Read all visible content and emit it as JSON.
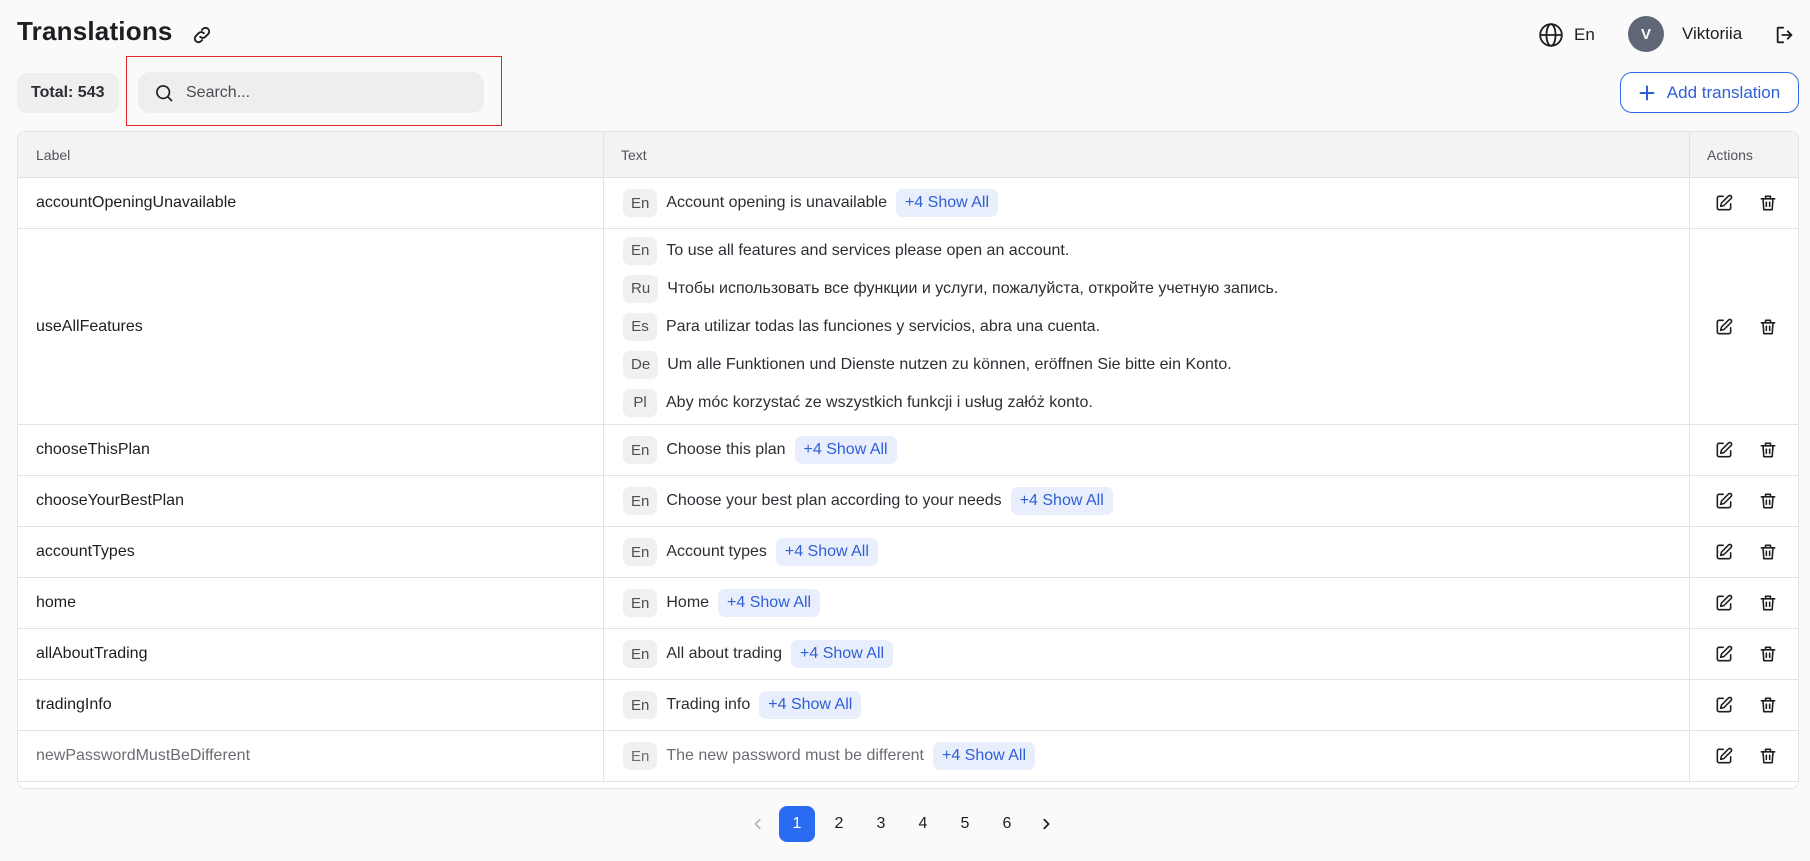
{
  "header": {
    "title": "Translations",
    "link_icon": "link-icon",
    "language": {
      "icon": "globe-icon",
      "label": "En"
    },
    "user": {
      "initial": "V",
      "name": "Viktoriia"
    },
    "logout_icon": "logout-icon"
  },
  "toolbar": {
    "total_label": "Total: 543",
    "search": {
      "placeholder": "Search...",
      "value": ""
    },
    "add_label": "Add translation"
  },
  "colors": {
    "accent": "#2a6cf1",
    "highlight_border": "#e0282e",
    "show_all_bg": "#e8eefc"
  },
  "table": {
    "columns": [
      "Label",
      "Text",
      "Actions"
    ],
    "rows": [
      {
        "label": "accountOpeningUnavailable",
        "texts": [
          {
            "lang": "En",
            "text": "Account opening is unavailable"
          }
        ],
        "show_all": "+4 Show All"
      },
      {
        "label": "useAllFeatures",
        "texts": [
          {
            "lang": "En",
            "text": "To use all features and services please open an account."
          },
          {
            "lang": "Ru",
            "text": "Чтобы использовать все функции и услуги, пожалуйста, откройте учетную запись."
          },
          {
            "lang": "Es",
            "text": "Para utilizar todas las funciones y servicios, abra una cuenta."
          },
          {
            "lang": "De",
            "text": "Um alle Funktionen und Dienste nutzen zu können, eröffnen Sie bitte ein Konto."
          },
          {
            "lang": "Pl",
            "text": "Aby móc korzystać ze wszystkich funkcji i usług załóż konto."
          }
        ],
        "show_all": ""
      },
      {
        "label": "chooseThisPlan",
        "texts": [
          {
            "lang": "En",
            "text": "Choose this plan"
          }
        ],
        "show_all": "+4 Show All"
      },
      {
        "label": "chooseYourBestPlan",
        "texts": [
          {
            "lang": "En",
            "text": "Choose your best plan according to your needs"
          }
        ],
        "show_all": "+4 Show All"
      },
      {
        "label": "accountTypes",
        "texts": [
          {
            "lang": "En",
            "text": "Account types"
          }
        ],
        "show_all": "+4 Show All"
      },
      {
        "label": "home",
        "texts": [
          {
            "lang": "En",
            "text": "Home"
          }
        ],
        "show_all": "+4 Show All"
      },
      {
        "label": "allAboutTrading",
        "texts": [
          {
            "lang": "En",
            "text": "All about trading"
          }
        ],
        "show_all": "+4 Show All"
      },
      {
        "label": "tradingInfo",
        "texts": [
          {
            "lang": "En",
            "text": "Trading info"
          }
        ],
        "show_all": "+4 Show All"
      },
      {
        "label": "newPasswordMustBeDifferent",
        "texts": [
          {
            "lang": "En",
            "text": "The new password must be different"
          }
        ],
        "show_all": "+4 Show All"
      }
    ]
  },
  "pagination": {
    "pages": [
      "1",
      "2",
      "3",
      "4",
      "5",
      "6"
    ],
    "current": "1"
  }
}
